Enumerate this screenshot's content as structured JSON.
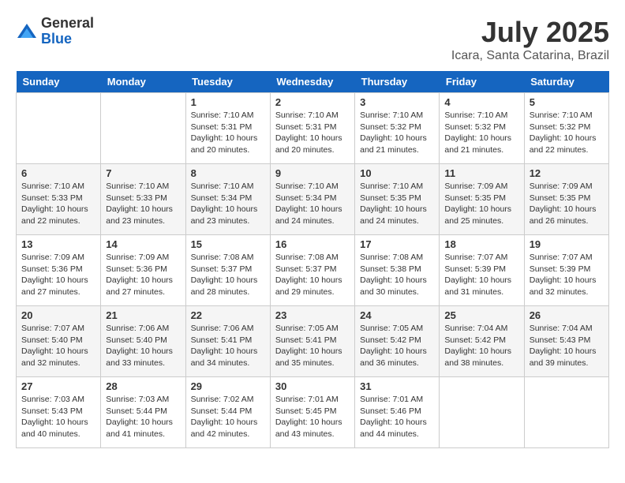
{
  "header": {
    "logo_general": "General",
    "logo_blue": "Blue",
    "title": "July 2025",
    "subtitle": "Icara, Santa Catarina, Brazil"
  },
  "days_of_week": [
    "Sunday",
    "Monday",
    "Tuesday",
    "Wednesday",
    "Thursday",
    "Friday",
    "Saturday"
  ],
  "weeks": [
    [
      {
        "day": "",
        "info": ""
      },
      {
        "day": "",
        "info": ""
      },
      {
        "day": "1",
        "info": "Sunrise: 7:10 AM\nSunset: 5:31 PM\nDaylight: 10 hours\nand 20 minutes."
      },
      {
        "day": "2",
        "info": "Sunrise: 7:10 AM\nSunset: 5:31 PM\nDaylight: 10 hours\nand 20 minutes."
      },
      {
        "day": "3",
        "info": "Sunrise: 7:10 AM\nSunset: 5:32 PM\nDaylight: 10 hours\nand 21 minutes."
      },
      {
        "day": "4",
        "info": "Sunrise: 7:10 AM\nSunset: 5:32 PM\nDaylight: 10 hours\nand 21 minutes."
      },
      {
        "day": "5",
        "info": "Sunrise: 7:10 AM\nSunset: 5:32 PM\nDaylight: 10 hours\nand 22 minutes."
      }
    ],
    [
      {
        "day": "6",
        "info": "Sunrise: 7:10 AM\nSunset: 5:33 PM\nDaylight: 10 hours\nand 22 minutes."
      },
      {
        "day": "7",
        "info": "Sunrise: 7:10 AM\nSunset: 5:33 PM\nDaylight: 10 hours\nand 23 minutes."
      },
      {
        "day": "8",
        "info": "Sunrise: 7:10 AM\nSunset: 5:34 PM\nDaylight: 10 hours\nand 23 minutes."
      },
      {
        "day": "9",
        "info": "Sunrise: 7:10 AM\nSunset: 5:34 PM\nDaylight: 10 hours\nand 24 minutes."
      },
      {
        "day": "10",
        "info": "Sunrise: 7:10 AM\nSunset: 5:35 PM\nDaylight: 10 hours\nand 24 minutes."
      },
      {
        "day": "11",
        "info": "Sunrise: 7:09 AM\nSunset: 5:35 PM\nDaylight: 10 hours\nand 25 minutes."
      },
      {
        "day": "12",
        "info": "Sunrise: 7:09 AM\nSunset: 5:35 PM\nDaylight: 10 hours\nand 26 minutes."
      }
    ],
    [
      {
        "day": "13",
        "info": "Sunrise: 7:09 AM\nSunset: 5:36 PM\nDaylight: 10 hours\nand 27 minutes."
      },
      {
        "day": "14",
        "info": "Sunrise: 7:09 AM\nSunset: 5:36 PM\nDaylight: 10 hours\nand 27 minutes."
      },
      {
        "day": "15",
        "info": "Sunrise: 7:08 AM\nSunset: 5:37 PM\nDaylight: 10 hours\nand 28 minutes."
      },
      {
        "day": "16",
        "info": "Sunrise: 7:08 AM\nSunset: 5:37 PM\nDaylight: 10 hours\nand 29 minutes."
      },
      {
        "day": "17",
        "info": "Sunrise: 7:08 AM\nSunset: 5:38 PM\nDaylight: 10 hours\nand 30 minutes."
      },
      {
        "day": "18",
        "info": "Sunrise: 7:07 AM\nSunset: 5:39 PM\nDaylight: 10 hours\nand 31 minutes."
      },
      {
        "day": "19",
        "info": "Sunrise: 7:07 AM\nSunset: 5:39 PM\nDaylight: 10 hours\nand 32 minutes."
      }
    ],
    [
      {
        "day": "20",
        "info": "Sunrise: 7:07 AM\nSunset: 5:40 PM\nDaylight: 10 hours\nand 32 minutes."
      },
      {
        "day": "21",
        "info": "Sunrise: 7:06 AM\nSunset: 5:40 PM\nDaylight: 10 hours\nand 33 minutes."
      },
      {
        "day": "22",
        "info": "Sunrise: 7:06 AM\nSunset: 5:41 PM\nDaylight: 10 hours\nand 34 minutes."
      },
      {
        "day": "23",
        "info": "Sunrise: 7:05 AM\nSunset: 5:41 PM\nDaylight: 10 hours\nand 35 minutes."
      },
      {
        "day": "24",
        "info": "Sunrise: 7:05 AM\nSunset: 5:42 PM\nDaylight: 10 hours\nand 36 minutes."
      },
      {
        "day": "25",
        "info": "Sunrise: 7:04 AM\nSunset: 5:42 PM\nDaylight: 10 hours\nand 38 minutes."
      },
      {
        "day": "26",
        "info": "Sunrise: 7:04 AM\nSunset: 5:43 PM\nDaylight: 10 hours\nand 39 minutes."
      }
    ],
    [
      {
        "day": "27",
        "info": "Sunrise: 7:03 AM\nSunset: 5:43 PM\nDaylight: 10 hours\nand 40 minutes."
      },
      {
        "day": "28",
        "info": "Sunrise: 7:03 AM\nSunset: 5:44 PM\nDaylight: 10 hours\nand 41 minutes."
      },
      {
        "day": "29",
        "info": "Sunrise: 7:02 AM\nSunset: 5:44 PM\nDaylight: 10 hours\nand 42 minutes."
      },
      {
        "day": "30",
        "info": "Sunrise: 7:01 AM\nSunset: 5:45 PM\nDaylight: 10 hours\nand 43 minutes."
      },
      {
        "day": "31",
        "info": "Sunrise: 7:01 AM\nSunset: 5:46 PM\nDaylight: 10 hours\nand 44 minutes."
      },
      {
        "day": "",
        "info": ""
      },
      {
        "day": "",
        "info": ""
      }
    ]
  ]
}
